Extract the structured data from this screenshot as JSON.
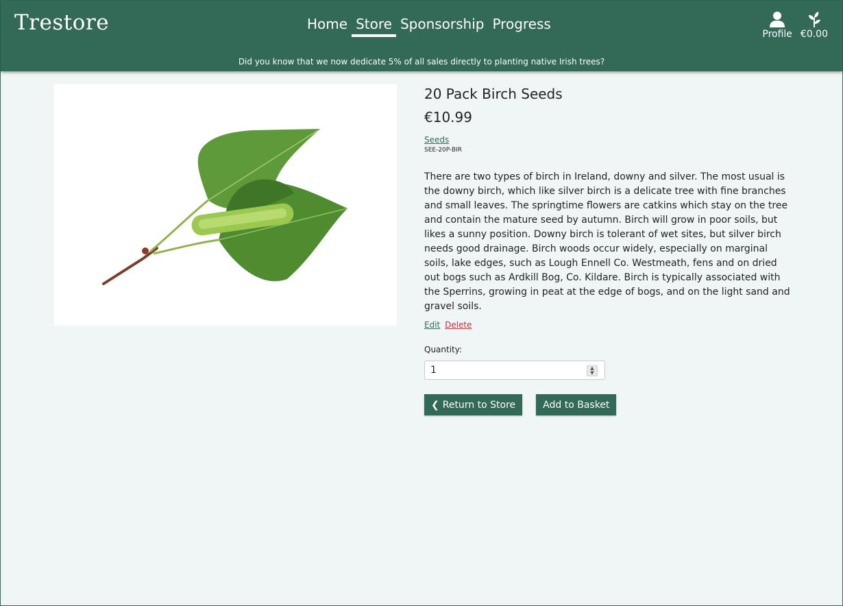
{
  "header": {
    "logo": "Trestore",
    "nav": [
      {
        "label": "Home",
        "active": false
      },
      {
        "label": "Store",
        "active": true
      },
      {
        "label": "Sponsorship",
        "active": false
      },
      {
        "label": "Progress",
        "active": false
      }
    ],
    "profile_label": "Profile",
    "basket_total": "€0.00",
    "banner": "Did you know that we now dedicate 5% of all sales directly to planting native Irish trees?"
  },
  "product": {
    "title": "20 Pack Birch Seeds",
    "price": "€10.99",
    "category": "Seeds",
    "sku": "SEE-20P-BIR",
    "description": "There are two types of birch in Ireland, downy and silver. The most usual is the downy birch, which like silver birch is a delicate tree with fine branches and small leaves. The springtime flowers are catkins which stay on the tree and contain the mature seed by autumn. Birch will grow in poor soils, but likes a sunny position. Downy birch is tolerant of wet sites, but silver birch needs good drainage. Birch woods occur widely, especially on marginal soils, lake edges, such as Lough Ennell Co. Westmeath, fens and on dried out bogs such as Ardkill Bog, Co. Kildare. Birch is typically associated with the Sperrins, growing in peat at the edge of bogs, and on the light sand and gravel soils.",
    "edit_label": "Edit",
    "delete_label": "Delete",
    "quantity_label": "Quantity:",
    "quantity_value": "1",
    "return_label": "Return to Store",
    "add_label": "Add to Basket"
  },
  "colors": {
    "brand": "#336957",
    "danger": "#c0303a",
    "background": "#f0f6f5"
  },
  "icons": [
    "user-icon",
    "sprout-icon",
    "chevron-left-icon"
  ]
}
